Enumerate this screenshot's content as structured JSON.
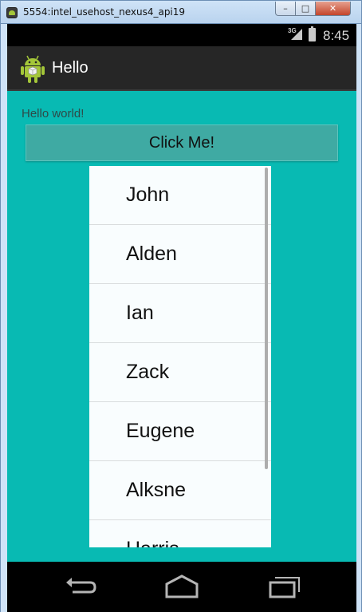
{
  "window": {
    "title": "5554:intel_usehost_nexus4_api19",
    "minimize_label": "–",
    "maximize_label": "□",
    "close_label": "✕"
  },
  "status_bar": {
    "network": "3G",
    "time": "8:45"
  },
  "action_bar": {
    "title": "Hello",
    "icon": "android-robot-icon"
  },
  "content": {
    "hello_text": "Hello world!",
    "button_label": "Click Me!",
    "list_items": [
      "John",
      "Alden",
      "Ian",
      "Zack",
      "Eugene",
      "Alksne",
      "Harris"
    ]
  },
  "nav_bar": {
    "icons": [
      "back-icon",
      "home-icon",
      "recents-icon"
    ]
  },
  "colors": {
    "background": "#08bab3",
    "button": "#3faaa3",
    "list_background": "#f9fdfe",
    "action_bar": "#262626"
  }
}
